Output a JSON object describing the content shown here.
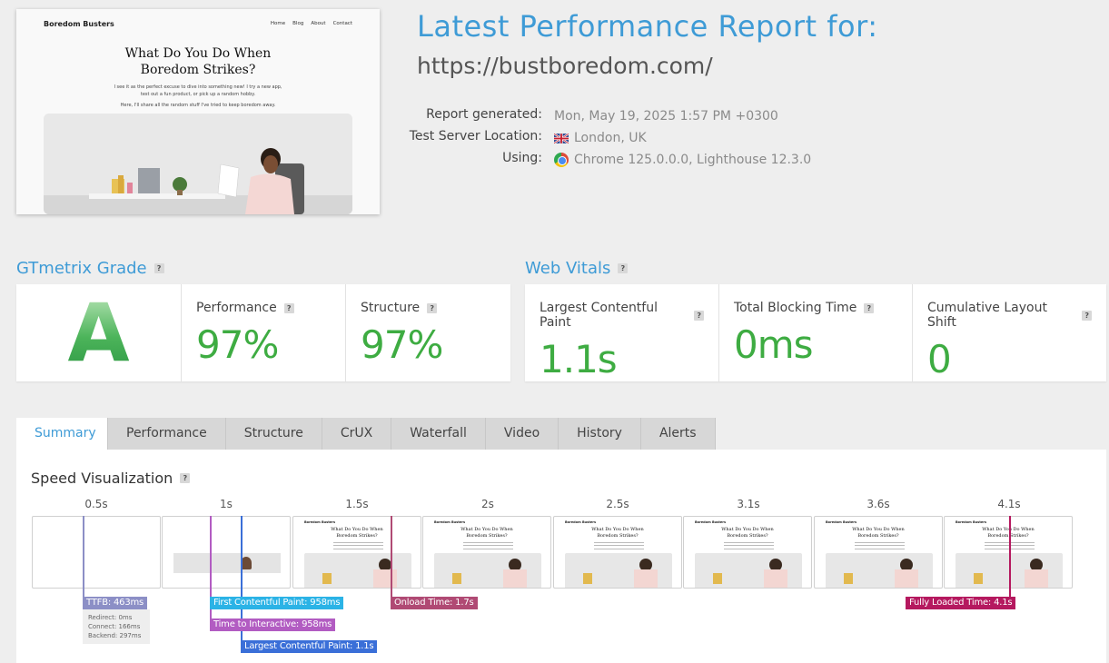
{
  "preview": {
    "brand": "Boredom Busters",
    "nav": [
      "Home",
      "Blog",
      "About",
      "Contact"
    ],
    "hero_title_line1": "What Do You Do When",
    "hero_title_line2": "Boredom Strikes?",
    "paragraph1": "I see it as the perfect excuse to dive into something new! I try a new app, test out a fun product, or pick up a random hobby.",
    "paragraph2": "Here, I'll share all the random stuff I've tried to keep boredom away."
  },
  "header": {
    "title": "Latest Performance Report for:",
    "url": "https://bustboredom.com/",
    "rows": [
      {
        "key": "Report generated:",
        "value": "Mon, May 19, 2025 1:57 PM +0300"
      },
      {
        "key": "Test Server Location:",
        "value": "London, UK",
        "icon": "uk-flag-icon"
      },
      {
        "key": "Using:",
        "value": "Chrome 125.0.0.0, Lighthouse 12.3.0",
        "icon": "chrome-icon"
      }
    ]
  },
  "grade": {
    "title": "GTmetrix Grade",
    "letter": "A",
    "performance_label": "Performance",
    "performance_value": "97%",
    "structure_label": "Structure",
    "structure_value": "97%"
  },
  "vitals": {
    "title": "Web Vitals",
    "lcp_label": "Largest Contentful Paint",
    "lcp_value": "1.1s",
    "tbt_label": "Total Blocking Time",
    "tbt_value": "0ms",
    "cls_label": "Cumulative Layout Shift",
    "cls_value": "0"
  },
  "help_glyph": "?",
  "tabs": [
    "Summary",
    "Performance",
    "Structure",
    "CrUX",
    "Waterfall",
    "Video",
    "History",
    "Alerts"
  ],
  "active_tab": "Summary",
  "speed": {
    "title": "Speed Visualization",
    "ticks": [
      "0.5s",
      "1s",
      "1.5s",
      "2s",
      "2.5s",
      "3.1s",
      "3.6s",
      "4.1s"
    ],
    "markers": {
      "ttfb": "TTFB: 463ms",
      "fcp": "First Contentful Paint: 958ms",
      "tti": "Time to Interactive: 958ms",
      "lcp": "Largest Contentful Paint: 1.1s",
      "onload": "Onload Time: 1.7s",
      "fully": "Fully Loaded Time: 4.1s"
    },
    "ttfb_details": [
      "Redirect: 0ms",
      "Connect: 166ms",
      "Backend: 297ms"
    ]
  },
  "colors": {
    "accent": "#3e9bd6",
    "good": "#3eac42",
    "ttfb": "#8c8fc6",
    "fcp": "#2bb3e6",
    "tti": "#b25cc2",
    "lcp": "#3a6fd8",
    "onload": "#b04a74",
    "fully": "#b5195f"
  }
}
